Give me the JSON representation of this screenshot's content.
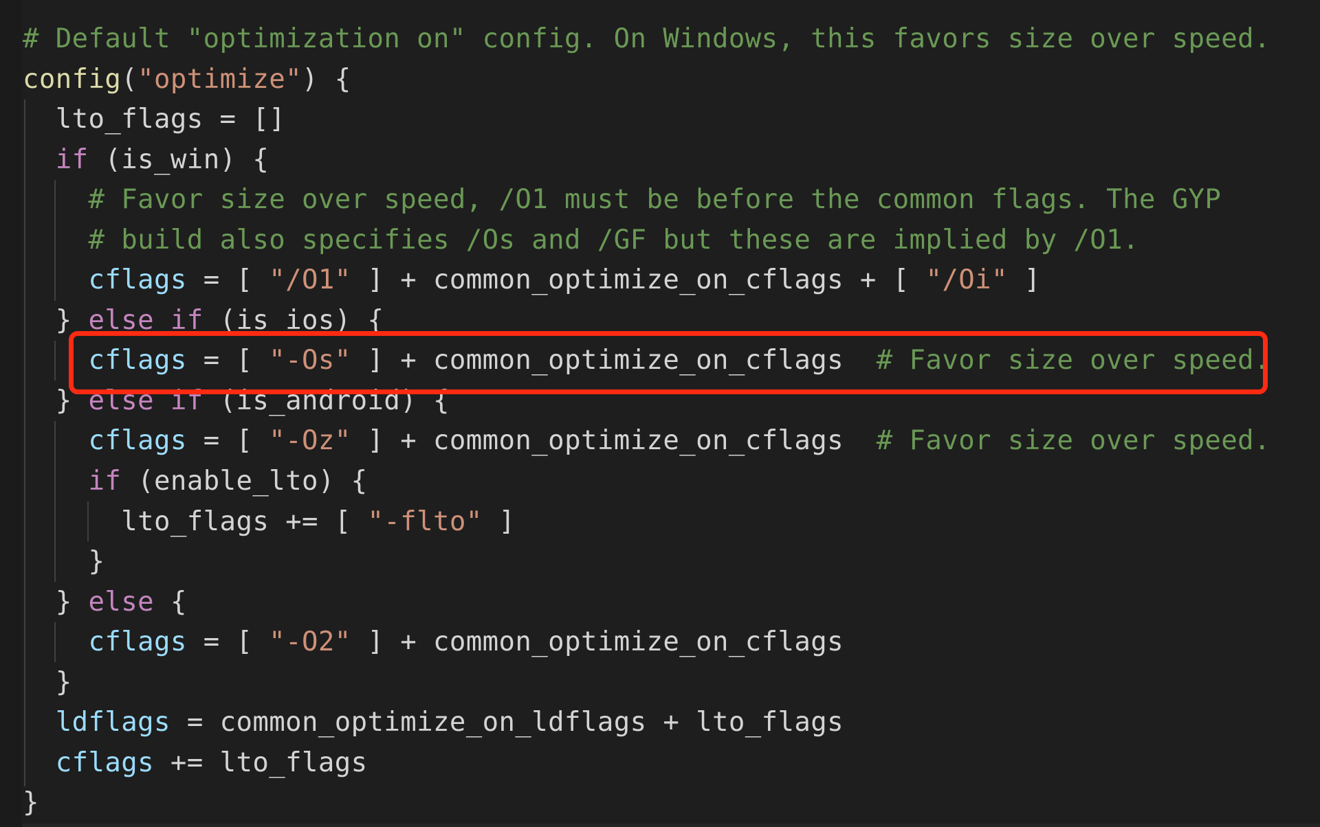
{
  "editor": {
    "theme_colors": {
      "background": "#1e1e1e",
      "comment": "#6a9955",
      "function": "#dcdcaa",
      "string": "#ce9178",
      "keyword": "#c586c0",
      "variable": "#9cdcfe",
      "plain": "#d4d4d4",
      "highlight_border": "#ff2a12"
    },
    "highlighted_line_index": 8,
    "lines": [
      [
        {
          "t": "comment",
          "v": "# Default \"optimization on\" config. On Windows, this favors size over speed."
        }
      ],
      [
        {
          "t": "func",
          "v": "config"
        },
        {
          "t": "plain",
          "v": "("
        },
        {
          "t": "string",
          "v": "\"optimize\""
        },
        {
          "t": "plain",
          "v": ") {"
        }
      ],
      [
        {
          "t": "plain",
          "v": "  lto_flags = []"
        }
      ],
      [
        {
          "t": "plain",
          "v": "  "
        },
        {
          "t": "keyword",
          "v": "if"
        },
        {
          "t": "plain",
          "v": " (is_win) {"
        }
      ],
      [
        {
          "t": "plain",
          "v": "    "
        },
        {
          "t": "comment",
          "v": "# Favor size over speed, /O1 must be before the common flags. The GYP"
        }
      ],
      [
        {
          "t": "plain",
          "v": "    "
        },
        {
          "t": "comment",
          "v": "# build also specifies /Os and /GF but these are implied by /O1."
        }
      ],
      [
        {
          "t": "plain",
          "v": "    "
        },
        {
          "t": "var",
          "v": "cflags"
        },
        {
          "t": "plain",
          "v": " = [ "
        },
        {
          "t": "string",
          "v": "\"/O1\""
        },
        {
          "t": "plain",
          "v": " ] + common_optimize_on_cflags + [ "
        },
        {
          "t": "string",
          "v": "\"/Oi\""
        },
        {
          "t": "plain",
          "v": " ]"
        }
      ],
      [
        {
          "t": "plain",
          "v": "  } "
        },
        {
          "t": "keyword",
          "v": "else if"
        },
        {
          "t": "plain",
          "v": " (is_ios) {"
        }
      ],
      [
        {
          "t": "plain",
          "v": "    "
        },
        {
          "t": "var",
          "v": "cflags"
        },
        {
          "t": "plain",
          "v": " = [ "
        },
        {
          "t": "string",
          "v": "\"-Os\""
        },
        {
          "t": "plain",
          "v": " ] + common_optimize_on_cflags  "
        },
        {
          "t": "comment",
          "v": "# Favor size over speed."
        }
      ],
      [
        {
          "t": "plain",
          "v": "  } "
        },
        {
          "t": "keyword",
          "v": "else if"
        },
        {
          "t": "plain",
          "v": " (is_android) {"
        }
      ],
      [
        {
          "t": "plain",
          "v": "    "
        },
        {
          "t": "var",
          "v": "cflags"
        },
        {
          "t": "plain",
          "v": " = [ "
        },
        {
          "t": "string",
          "v": "\"-Oz\""
        },
        {
          "t": "plain",
          "v": " ] + common_optimize_on_cflags  "
        },
        {
          "t": "comment",
          "v": "# Favor size over speed."
        }
      ],
      [
        {
          "t": "plain",
          "v": "    "
        },
        {
          "t": "keyword",
          "v": "if"
        },
        {
          "t": "plain",
          "v": " (enable_lto) {"
        }
      ],
      [
        {
          "t": "plain",
          "v": "      lto_flags += [ "
        },
        {
          "t": "string",
          "v": "\"-flto\""
        },
        {
          "t": "plain",
          "v": " ]"
        }
      ],
      [
        {
          "t": "plain",
          "v": "    }"
        }
      ],
      [
        {
          "t": "plain",
          "v": "  } "
        },
        {
          "t": "keyword",
          "v": "else"
        },
        {
          "t": "plain",
          "v": " {"
        }
      ],
      [
        {
          "t": "plain",
          "v": "    "
        },
        {
          "t": "var",
          "v": "cflags"
        },
        {
          "t": "plain",
          "v": " = [ "
        },
        {
          "t": "string",
          "v": "\"-O2\""
        },
        {
          "t": "plain",
          "v": " ] + common_optimize_on_cflags"
        }
      ],
      [
        {
          "t": "plain",
          "v": "  }"
        }
      ],
      [
        {
          "t": "plain",
          "v": "  "
        },
        {
          "t": "var",
          "v": "ldflags"
        },
        {
          "t": "plain",
          "v": " = common_optimize_on_ldflags + lto_flags"
        }
      ],
      [
        {
          "t": "plain",
          "v": "  "
        },
        {
          "t": "var",
          "v": "cflags"
        },
        {
          "t": "plain",
          "v": " += lto_flags"
        }
      ],
      [
        {
          "t": "plain",
          "v": "}"
        }
      ]
    ]
  }
}
